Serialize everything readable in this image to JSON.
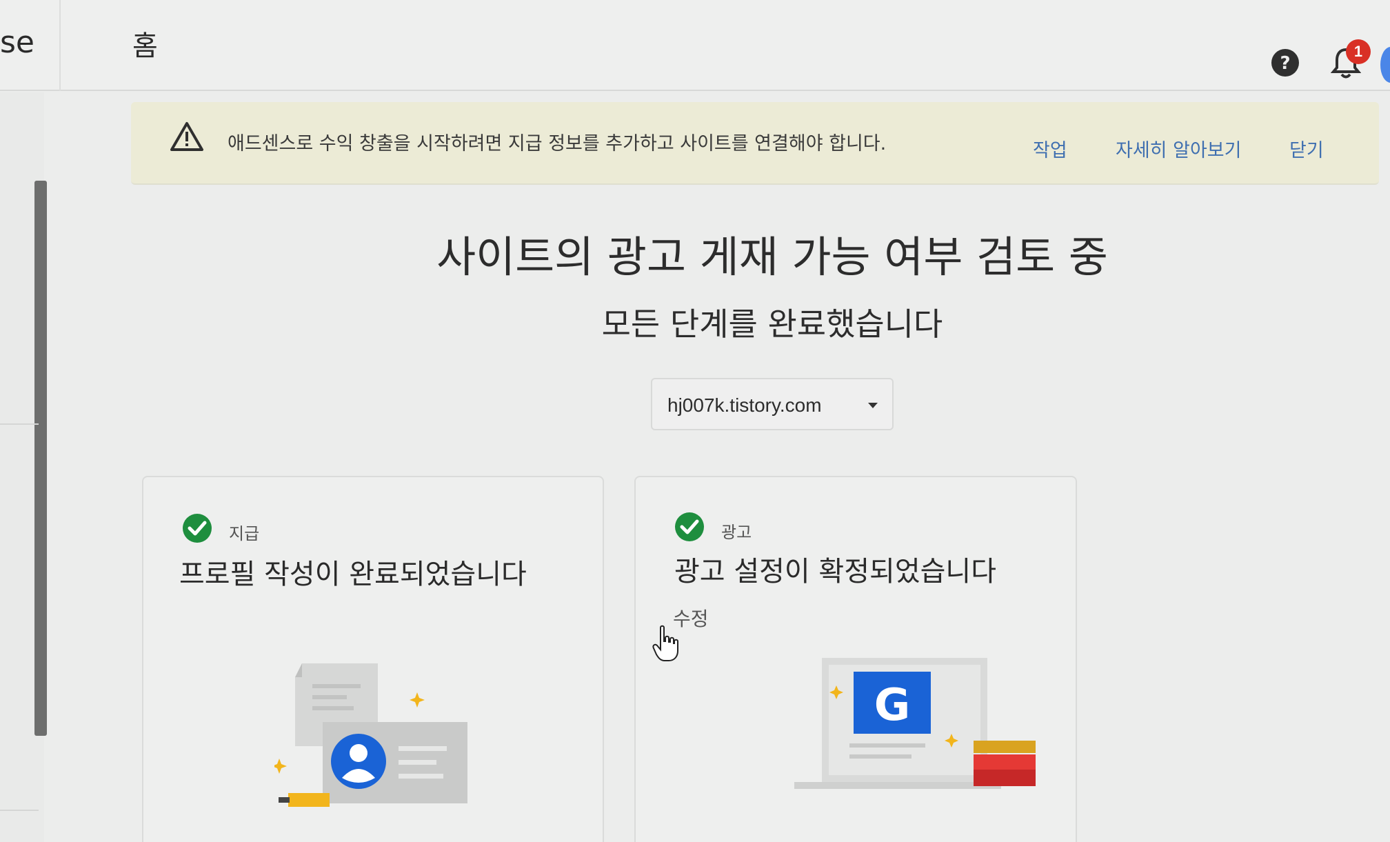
{
  "header": {
    "brand_fragment": "se",
    "page_title": "홈",
    "notification_count": "1",
    "icons": [
      "help-icon",
      "bell-icon"
    ]
  },
  "banner": {
    "icon": "warning-icon",
    "message": "애드센스로 수익 창출을 시작하려면 지급 정보를 추가하고 사이트를 연결해야 합니다.",
    "action_label": "작업",
    "learn_more_label": "자세히 알아보기",
    "close_label": "닫기"
  },
  "main": {
    "heading": "사이트의 광고 게재 가능 여부 검토 중",
    "subheading": "모든 단계를 완료했습니다",
    "site_selector": {
      "value": "hj007k.tistory.com"
    }
  },
  "cards": [
    {
      "label": "지급",
      "title": "프로필 작성이 완료되었습니다",
      "status_icon": "check-circle-icon",
      "illustration": "profile-document-illustration"
    },
    {
      "label": "광고",
      "title": "광고 설정이 확정되었습니다",
      "link_label": "수정",
      "status_icon": "check-circle-icon",
      "illustration": "google-ads-laptop-illustration"
    }
  ],
  "colors": {
    "accent_link": "#3f6fb0",
    "banner_bg": "#ecebd6",
    "check_green": "#1e8e3e",
    "badge_red": "#d93025",
    "google_blue": "#1a73e8"
  }
}
